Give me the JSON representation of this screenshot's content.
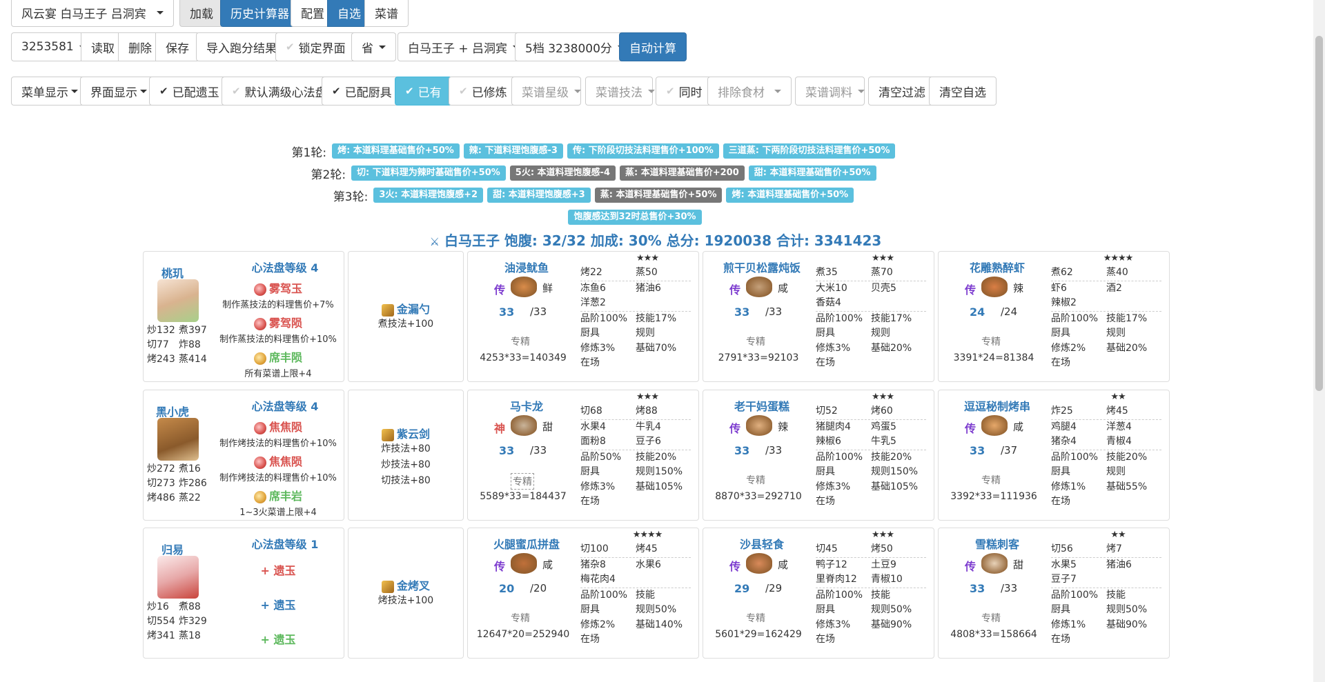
{
  "toolbar1": {
    "scheme_select": "风云宴 白马王子 吕洞宾",
    "load": "加载",
    "history_calc": "历史计算器",
    "config": "配置",
    "custom": "自选",
    "recipes": "菜谱"
  },
  "toolbar2": {
    "id": "3253581",
    "read": "读取",
    "delete": "删除",
    "save": "保存",
    "import": "导入跑分结果",
    "lock": "锁定界面",
    "province": "省",
    "target": "白马王子 + 吕洞宾",
    "level": "5档 3238000分",
    "auto": "自动计算"
  },
  "toolbar3": {
    "menu_display": "菜单显示",
    "ui_display": "界面显示",
    "assigned_jade": "已配遗玉",
    "default_disk": "默认满级心法盘",
    "assigned_tools": "已配厨具",
    "owned": "已有",
    "trained": "已修炼",
    "recipe_star": "菜谱星级",
    "recipe_skill": "菜谱技法",
    "same_time": "同时",
    "exclude_ingredients": "排除食材",
    "recipe_seasoning": "菜谱调料",
    "clear_filter": "清空过滤",
    "clear_custom": "清空自选"
  },
  "rounds": [
    {
      "label": "第1轮:",
      "badges": [
        {
          "text": "烤: 本道料理基础售价+50%",
          "color": "blue"
        },
        {
          "text": "辣: 下道料理饱腹感-3",
          "color": "blue"
        },
        {
          "text": "传: 下阶段切技法料理售价+100%",
          "color": "blue"
        },
        {
          "text": "三道蒸: 下两阶段切技法料理售价+50%",
          "color": "blue"
        }
      ]
    },
    {
      "label": "第2轮:",
      "badges": [
        {
          "text": "切: 下道料理为辣时基础售价+50%",
          "color": "blue"
        },
        {
          "text": "5火: 本道料理饱腹感-4",
          "color": "grey"
        },
        {
          "text": "蒸: 本道料理基础售价+200",
          "color": "grey"
        },
        {
          "text": "甜: 本道料理基础售价+50%",
          "color": "blue"
        }
      ]
    },
    {
      "label": "第3轮:",
      "badges": [
        {
          "text": "3火: 本道料理饱腹感+2",
          "color": "blue"
        },
        {
          "text": "甜: 本道料理饱腹感+3",
          "color": "blue"
        },
        {
          "text": "蒸: 本道料理基础售价+50%",
          "color": "grey"
        },
        {
          "text": "烤: 本道料理基础售价+50%",
          "color": "blue"
        }
      ]
    },
    {
      "label": "",
      "badges": [
        {
          "text": "饱腹感达到32时总售价+30%",
          "color": "blue"
        }
      ]
    }
  ],
  "summary": "白马王子 饱腹: 32/32 加成: 30% 总分: 1920038 合计: 3341423",
  "chefs": [
    {
      "name": "桃玑",
      "stats": [
        "炒132",
        "煮397",
        "切77",
        "炸88",
        "烤243",
        "蒸414"
      ],
      "disk_title": "心法盘等级 4",
      "jades": [
        {
          "name": "雾驾玉",
          "desc": "制作蒸技法的料理售价+7%",
          "color": "red"
        },
        {
          "name": "雾驾陨",
          "desc": "制作蒸技法的料理售价+10%",
          "color": "red"
        },
        {
          "name": "席丰陨",
          "desc": "所有菜谱上限+4",
          "color": "green"
        }
      ],
      "equip": {
        "name": "金漏勺",
        "desc": [
          "煮技法+100"
        ]
      },
      "recipes": [
        {
          "name": "油浸鱿鱼",
          "stars": "★★★",
          "rarity": "传",
          "cond": "鲜",
          "qty": "33",
          "max": "/33",
          "spec": "专精",
          "total": "4253*33=140349",
          "grid": [
            [
              "烤22",
              "蒸50"
            ],
            [
              "冻鱼6",
              "猪油6"
            ],
            [
              "洋葱2",
              ""
            ],
            [
              "品阶100%",
              "技能17%"
            ],
            [
              "厨具",
              "规则"
            ],
            [
              "修炼3%",
              "基础70%"
            ],
            [
              "在场",
              ""
            ]
          ]
        },
        {
          "name": "煎干贝松露炖饭",
          "stars": "★★★",
          "rarity": "传",
          "cond": "咸",
          "qty": "33",
          "max": "/33",
          "spec": "专精",
          "total": "2791*33=92103",
          "grid": [
            [
              "煮35",
              "蒸70"
            ],
            [
              "大米10",
              "贝壳5"
            ],
            [
              "香菇4",
              ""
            ],
            [
              "品阶100%",
              "技能17%"
            ],
            [
              "厨具",
              "规则"
            ],
            [
              "修炼3%",
              "基础20%"
            ],
            [
              "在场",
              ""
            ]
          ]
        },
        {
          "name": "花雕熟醉虾",
          "stars": "★★★★",
          "rarity": "传",
          "cond": "辣",
          "qty": "24",
          "max": "/24",
          "spec": "专精",
          "total": "3391*24=81384",
          "grid": [
            [
              "煮62",
              "蒸40"
            ],
            [
              "虾6",
              "酒2"
            ],
            [
              "辣椒2",
              ""
            ],
            [
              "品阶100%",
              "技能17%"
            ],
            [
              "厨具",
              "规则"
            ],
            [
              "修炼2%",
              "基础20%"
            ],
            [
              "在场",
              ""
            ]
          ]
        }
      ]
    },
    {
      "name": "黑小虎",
      "stats": [
        "炒272",
        "煮16",
        "切273",
        "炸286",
        "烤486",
        "蒸22"
      ],
      "disk_title": "心法盘等级 4",
      "jades": [
        {
          "name": "焦焦陨",
          "desc": "制作烤技法的料理售价+10%",
          "color": "red"
        },
        {
          "name": "焦焦陨",
          "desc": "制作烤技法的料理售价+10%",
          "color": "red"
        },
        {
          "name": "席丰岩",
          "desc": "1~3火菜谱上限+4",
          "color": "green"
        }
      ],
      "equip": {
        "name": "紫云剑",
        "desc": [
          "炸技法+80",
          "炒技法+80",
          "切技法+80"
        ]
      },
      "recipes": [
        {
          "name": "马卡龙",
          "stars": "★★★",
          "rarity": "神",
          "cond": "甜",
          "qty": "33",
          "max": "/33",
          "spec": "专精",
          "total": "5589*33=184437",
          "grid": [
            [
              "切68",
              "烤88"
            ],
            [
              "水果4",
              "牛乳4"
            ],
            [
              "面粉8",
              "豆子6"
            ],
            [
              "品阶50%",
              "技能20%"
            ],
            [
              "厨具",
              "规则150%"
            ],
            [
              "修炼3%",
              "基础105%"
            ],
            [
              "在场",
              ""
            ]
          ]
        },
        {
          "name": "老干妈蛋糕",
          "stars": "★★★",
          "rarity": "传",
          "cond": "辣",
          "qty": "33",
          "max": "/33",
          "spec": "专精",
          "total": "8870*33=292710",
          "grid": [
            [
              "切52",
              "烤60"
            ],
            [
              "猪腿肉4",
              "鸡蛋5"
            ],
            [
              "辣椒6",
              "牛乳5"
            ],
            [
              "品阶100%",
              "技能20%"
            ],
            [
              "厨具",
              "规则150%"
            ],
            [
              "修炼3%",
              "基础105%"
            ],
            [
              "在场",
              ""
            ]
          ]
        },
        {
          "name": "逗逗秘制烤串",
          "stars": "★★",
          "rarity": "传",
          "cond": "咸",
          "qty": "33",
          "max": "/37",
          "spec": "专精",
          "total": "3392*33=111936",
          "grid": [
            [
              "炸25",
              "烤45"
            ],
            [
              "鸡腿4",
              "洋葱4"
            ],
            [
              "猪杂4",
              "青椒4"
            ],
            [
              "品阶100%",
              "技能20%"
            ],
            [
              "厨具",
              "规则"
            ],
            [
              "修炼1%",
              "基础55%"
            ],
            [
              "在场",
              ""
            ]
          ]
        }
      ]
    },
    {
      "name": "归易",
      "stats": [
        "炒16",
        "煮88",
        "切554",
        "炸329",
        "烤341",
        "蒸18"
      ],
      "disk_title": "心法盘等级 1",
      "jades": [
        {
          "name": "遗玉",
          "desc": "",
          "color": "red"
        },
        {
          "name": "遗玉",
          "desc": "",
          "color": "blue"
        },
        {
          "name": "遗玉",
          "desc": "",
          "color": "green"
        }
      ],
      "equip": {
        "name": "金烤叉",
        "desc": [
          "烤技法+100"
        ]
      },
      "recipes": [
        {
          "name": "火腿蜜瓜拼盘",
          "stars": "★★★★",
          "rarity": "传",
          "cond": "咸",
          "qty": "20",
          "max": "/20",
          "spec": "专精",
          "total": "12647*20=252940",
          "grid": [
            [
              "切100",
              "烤45"
            ],
            [
              "猪杂8",
              "水果6"
            ],
            [
              "梅花肉4",
              ""
            ],
            [
              "品阶100%",
              "技能"
            ],
            [
              "厨具",
              "规则50%"
            ],
            [
              "修炼2%",
              "基础140%"
            ],
            [
              "在场",
              ""
            ]
          ]
        },
        {
          "name": "沙县轻食",
          "stars": "★★★",
          "rarity": "传",
          "cond": "咸",
          "qty": "29",
          "max": "/29",
          "spec": "专精",
          "total": "5601*29=162429",
          "grid": [
            [
              "切45",
              "烤50"
            ],
            [
              "鸭子12",
              "土豆9"
            ],
            [
              "里脊肉12",
              "青椒10"
            ],
            [
              "品阶100%",
              "技能"
            ],
            [
              "厨具",
              "规则50%"
            ],
            [
              "修炼3%",
              "基础90%"
            ],
            [
              "在场",
              ""
            ]
          ]
        },
        {
          "name": "雪糕刺客",
          "stars": "★★",
          "rarity": "传",
          "cond": "甜",
          "qty": "33",
          "max": "/33",
          "spec": "专精",
          "total": "4808*33=158664",
          "grid": [
            [
              "切56",
              "烤7"
            ],
            [
              "水果5",
              "猪油6"
            ],
            [
              "豆子7",
              ""
            ],
            [
              "品阶100%",
              "技能"
            ],
            [
              "厨具",
              "规则50%"
            ],
            [
              "修炼1%",
              "基础90%"
            ],
            [
              "在场",
              ""
            ]
          ]
        }
      ]
    }
  ]
}
